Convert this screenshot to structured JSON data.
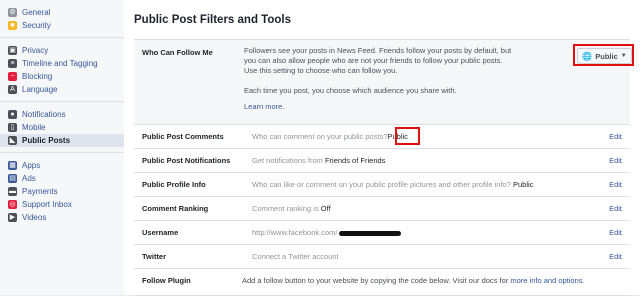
{
  "sidebar": {
    "groups": [
      [
        {
          "label": "General",
          "icon": "gear-icon",
          "color": "#90949c"
        },
        {
          "label": "Security",
          "icon": "security-badge-icon",
          "color": "#f7b928"
        }
      ],
      [
        {
          "label": "Privacy",
          "icon": "privacy-lock-icon",
          "color": "#4b4f56"
        },
        {
          "label": "Timeline and Tagging",
          "icon": "timeline-icon",
          "color": "#4b4f56"
        },
        {
          "label": "Blocking",
          "icon": "blocking-icon",
          "color": "#e41e3f"
        },
        {
          "label": "Language",
          "icon": "language-icon",
          "color": "#4b4f56"
        }
      ],
      [
        {
          "label": "Notifications",
          "icon": "globe-icon",
          "color": "#4b4f56"
        },
        {
          "label": "Mobile",
          "icon": "mobile-icon",
          "color": "#4b4f56"
        },
        {
          "label": "Public Posts",
          "icon": "rss-icon",
          "color": "#4b4f56",
          "active": true
        }
      ],
      [
        {
          "label": "Apps",
          "icon": "apps-icon",
          "color": "#3b5998"
        },
        {
          "label": "Ads",
          "icon": "ads-icon",
          "color": "#3b5998"
        },
        {
          "label": "Payments",
          "icon": "payments-icon",
          "color": "#4b4f56"
        },
        {
          "label": "Support Inbox",
          "icon": "support-icon",
          "color": "#e41e3f"
        },
        {
          "label": "Videos",
          "icon": "video-icon",
          "color": "#4b4f56"
        }
      ]
    ]
  },
  "main": {
    "title": "Public Post Filters and Tools",
    "who_can_follow": {
      "label": "Who Can Follow Me",
      "lines": [
        "Followers see your posts in News Feed. Friends follow your posts by default, but",
        "you can also allow people who are not your friends to follow your public posts.",
        "Use this setting to choose who can follow you."
      ],
      "note": "Each time you post, you choose which audience you share with.",
      "learn_more": "Learn more.",
      "button": "Public"
    },
    "rows": [
      {
        "label": "Public Post Comments",
        "prefix": "Who can comment on your public posts?",
        "value": "Public",
        "edit": "Edit"
      },
      {
        "label": "Public Post Notifications",
        "prefix": "Get notifications from",
        "value": "Friends of Friends",
        "edit": "Edit"
      },
      {
        "label": "Public Profile Info",
        "prefix": "Who can like or comment on your public profile pictures and other profile info?",
        "value": "Public",
        "edit": "Edit"
      },
      {
        "label": "Comment Ranking",
        "prefix": "Comment ranking is",
        "value": "Off",
        "edit": "Edit"
      },
      {
        "label": "Username",
        "prefix": "http://www.facebook.com/",
        "value": "",
        "edit": "Edit"
      },
      {
        "label": "Twitter",
        "prefix": "Connect a Twitter account",
        "value": "",
        "edit": "Edit"
      },
      {
        "label": "Follow Plugin",
        "prefix": "Add a follow button to your website by copying the code below. Visit our docs for",
        "value": "more info and options.",
        "edit": ""
      }
    ]
  }
}
